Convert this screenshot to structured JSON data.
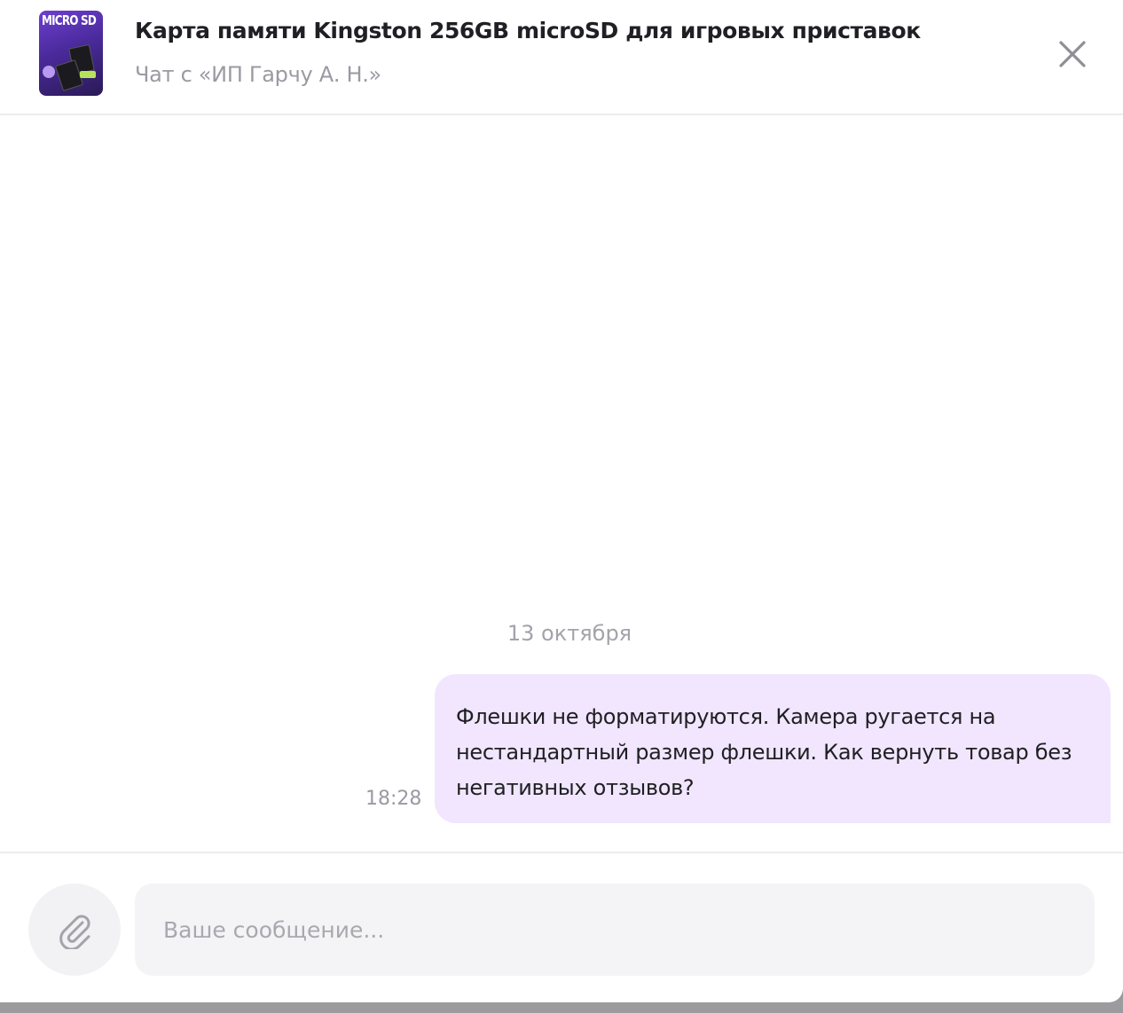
{
  "header": {
    "product_title": "Карта памяти Kingston 256GB microSD для игровых приставок",
    "chat_with": "Чат с «ИП Гарчу А. Н.»",
    "thumbnail_label": "MICRO SD",
    "close_icon": "close-icon"
  },
  "conversation": {
    "date_label": "13 октября",
    "messages": [
      {
        "time": "18:28",
        "text": "Флешки не форматируются. Камера ругается на нестандартный размер флешки. Как вернуть товар без негативных отзывов?",
        "direction": "outgoing"
      }
    ]
  },
  "composer": {
    "placeholder": "Ваше сообщение...",
    "value": "",
    "attach_icon": "paperclip-icon"
  },
  "colors": {
    "outgoing_bubble": "#f1e6fd",
    "secondary_text": "#9a9aa2",
    "primary_text": "#1f1f24"
  }
}
